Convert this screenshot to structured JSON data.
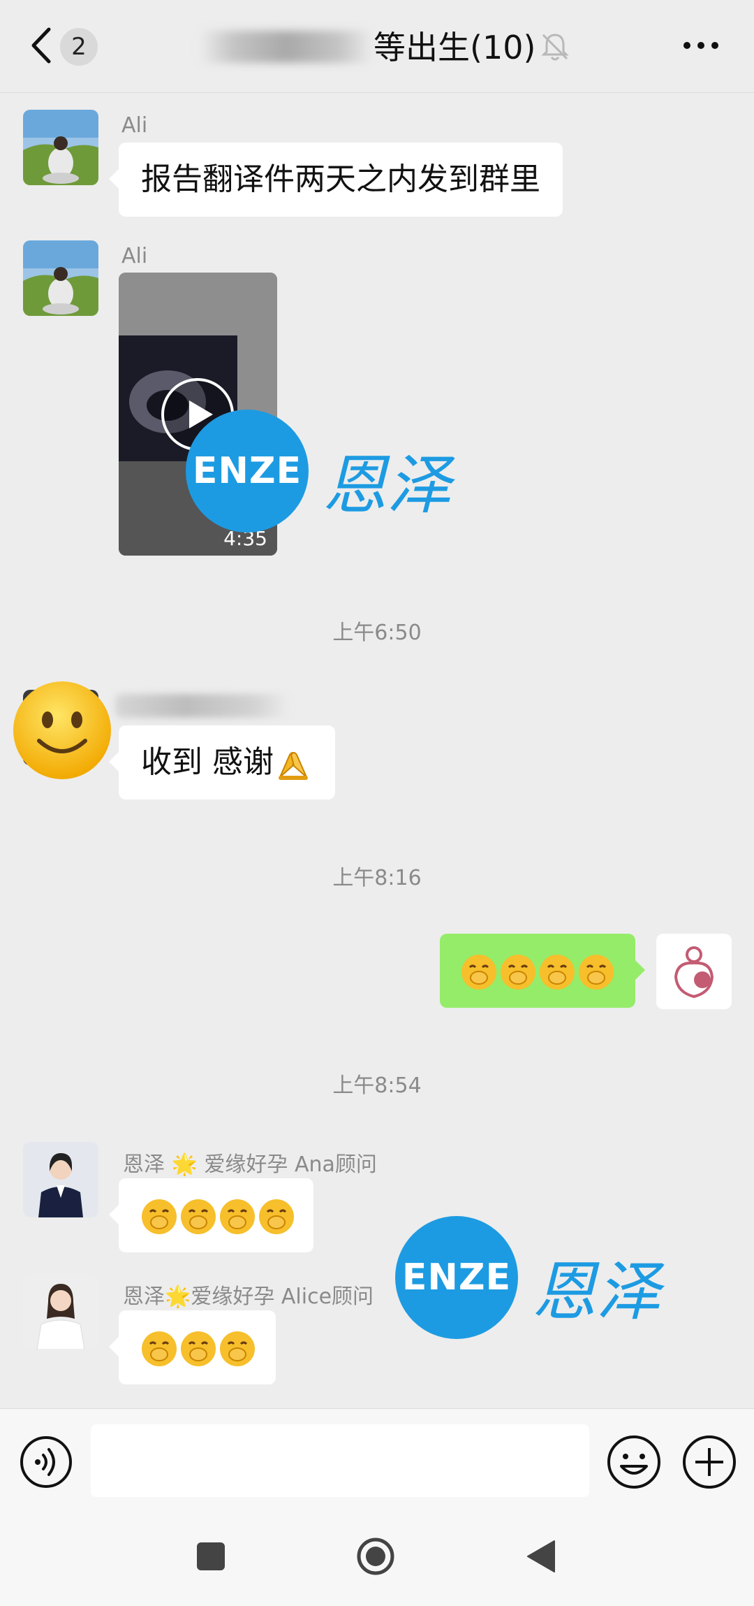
{
  "header": {
    "unread_count": "2",
    "title": "等出生(10)"
  },
  "messages": [
    {
      "sender": "Ali",
      "text": "报告翻译件两天之内发到群里"
    },
    {
      "sender": "Ali",
      "video_duration": "4:35"
    },
    {
      "timestamp": "上午6:50"
    },
    {
      "text": "收到  感谢"
    },
    {
      "timestamp": "上午8:16"
    },
    {
      "timestamp": "上午8:54"
    },
    {
      "sender": "恩泽 🌟 爱缘好孕 Ana顾问"
    },
    {
      "sender": "恩泽🌟爱缘好孕 Alice顾问"
    }
  ],
  "watermark": {
    "logo_text": "ENZE",
    "brand_text": "恩泽"
  },
  "colors": {
    "background": "#ededed",
    "green_bubble": "#95ec69",
    "watermark_blue": "#1d9be2"
  },
  "icons": [
    "back-chevron-icon",
    "mute-bell-icon",
    "more-dots-icon",
    "play-icon",
    "voice-icon",
    "emoji-icon",
    "plus-icon",
    "hush-emoji-icon",
    "pray-emoji-icon"
  ]
}
